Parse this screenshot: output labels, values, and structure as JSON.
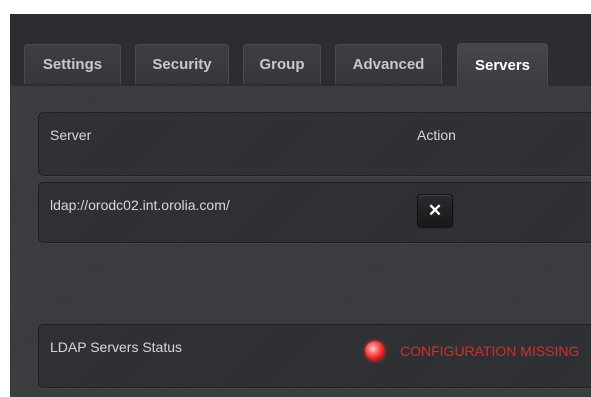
{
  "tabs": [
    {
      "label": "Settings",
      "active": false
    },
    {
      "label": "Security",
      "active": false
    },
    {
      "label": "Group",
      "active": false
    },
    {
      "label": "Advanced",
      "active": false
    },
    {
      "label": "Servers",
      "active": true
    }
  ],
  "table": {
    "headers": {
      "server": "Server",
      "action": "Action"
    },
    "rows": [
      {
        "server": "ldap://orodc02.int.orolia.com/",
        "action_icon": "close-icon",
        "action_glyph": "✕"
      }
    ]
  },
  "status": {
    "label": "LDAP Servers Status",
    "indicator_color": "#e21c1c",
    "text": "CONFIGURATION MISSING"
  },
  "colors": {
    "panel_bg": "#3b3c40",
    "status_red": "#d92b2b"
  }
}
